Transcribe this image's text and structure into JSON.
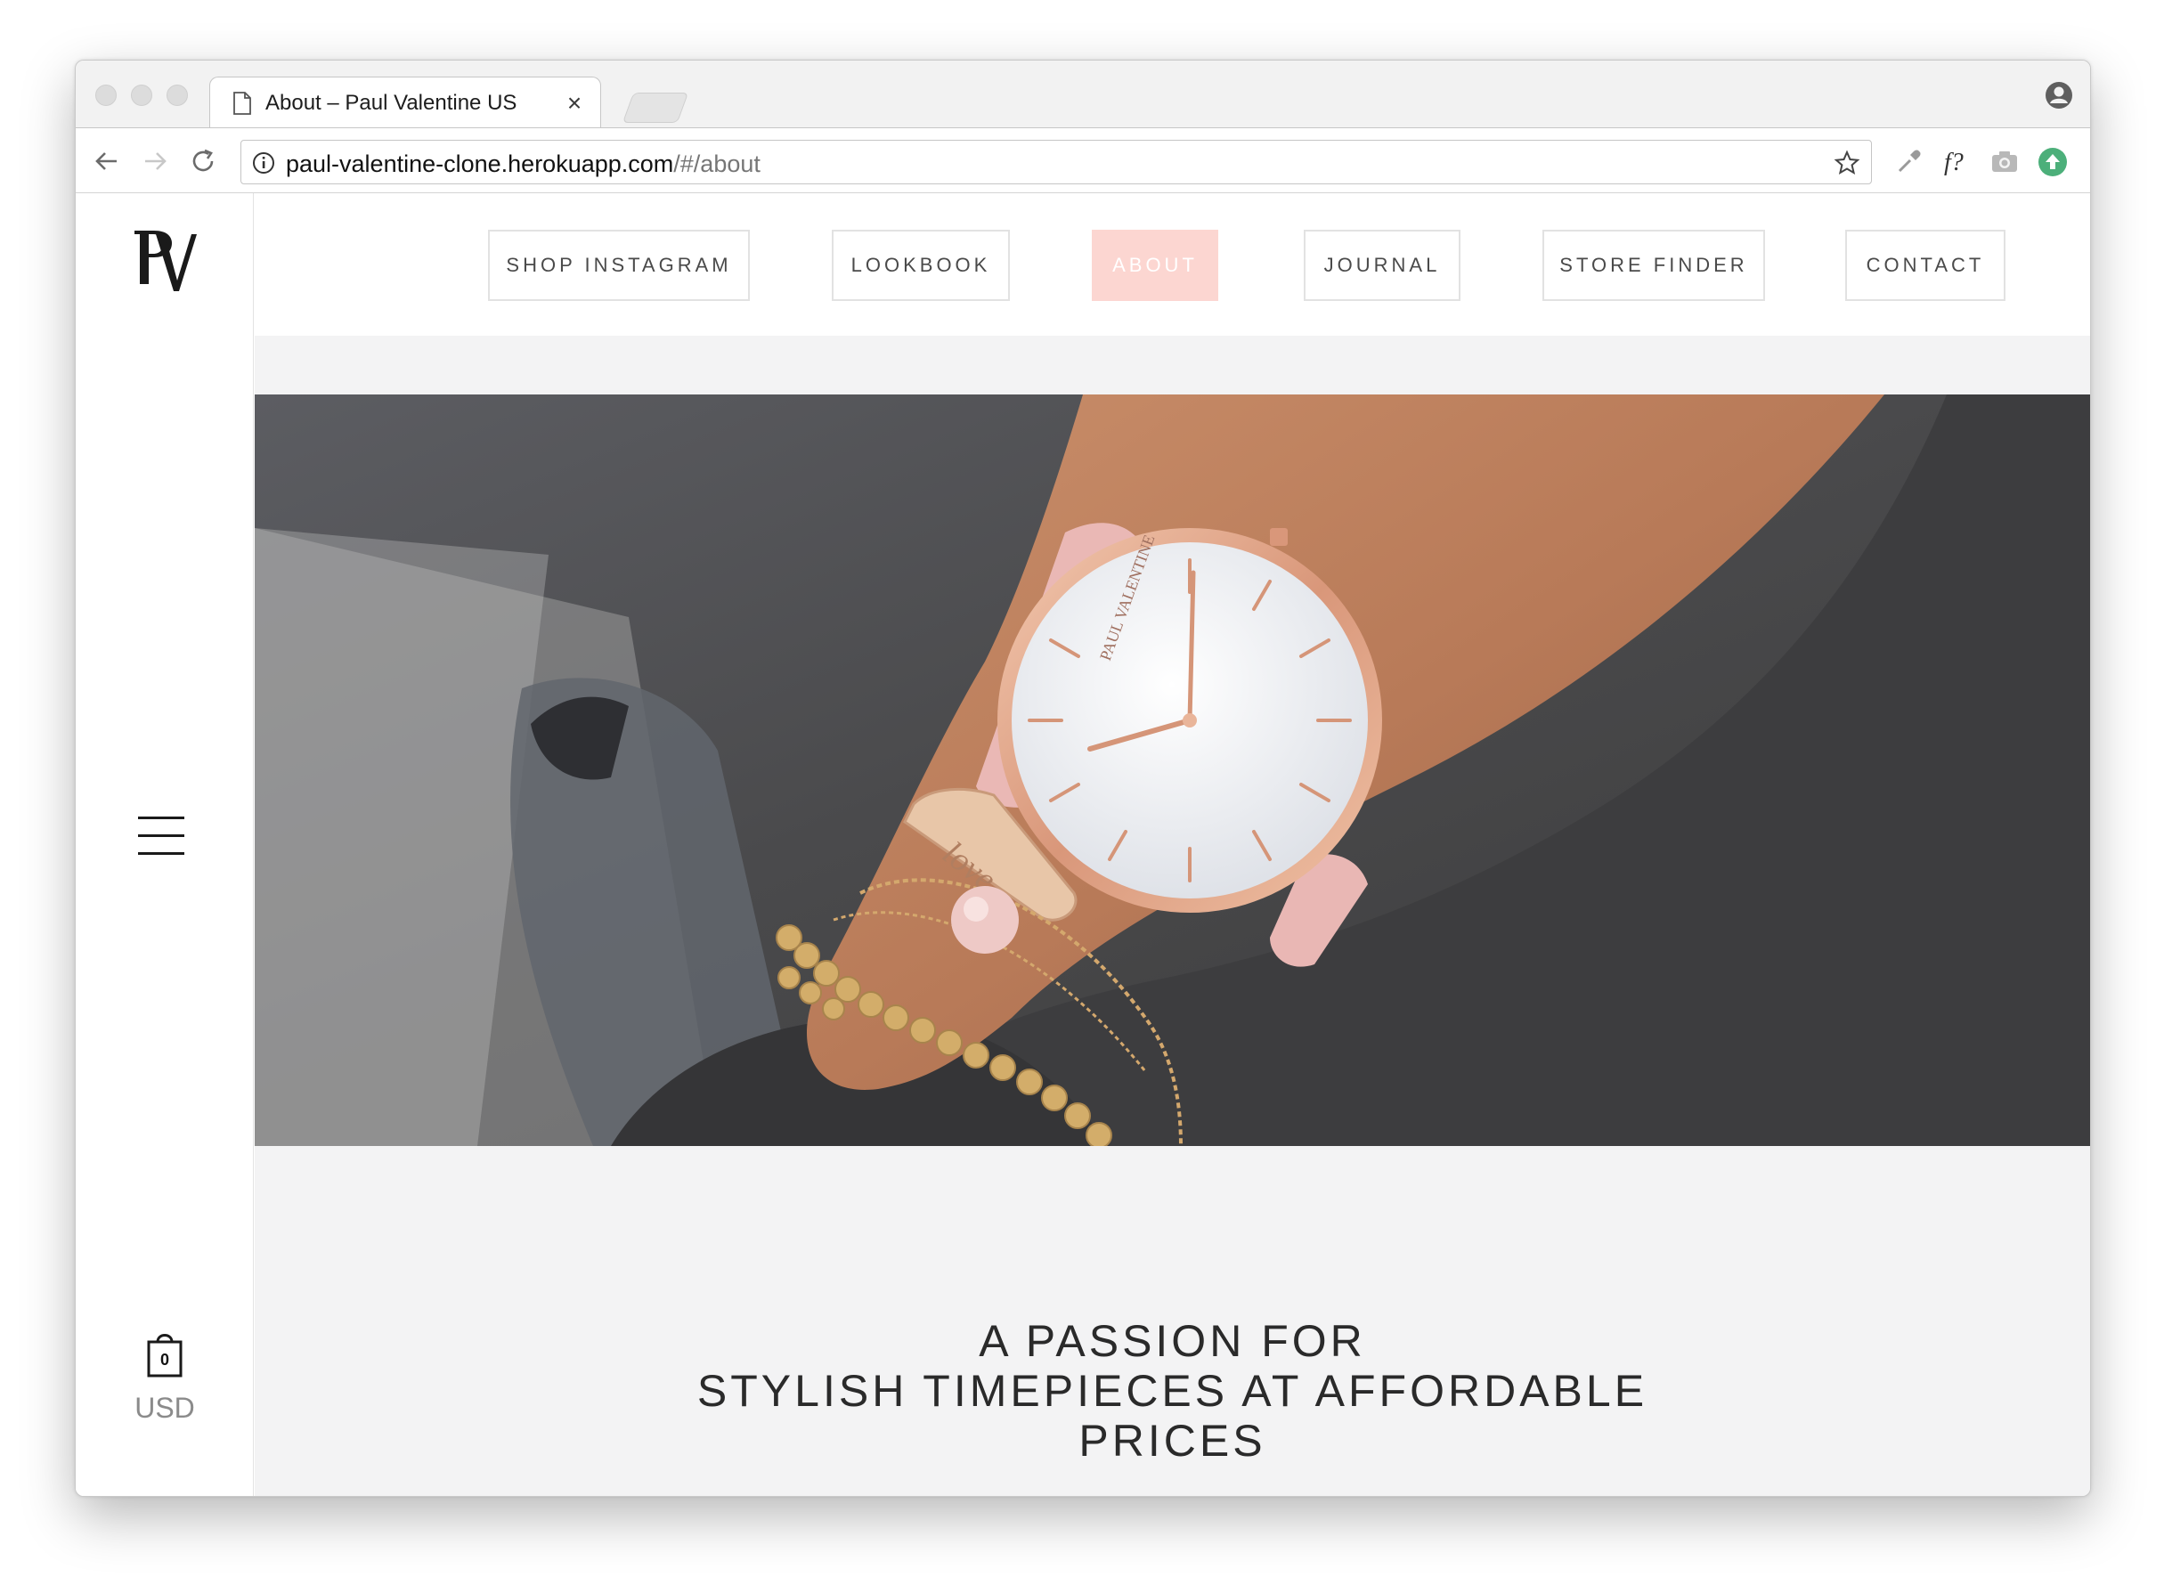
{
  "browser": {
    "tab_title": "About – Paul Valentine US",
    "tab_close": "×",
    "url_host": "paul-valentine-clone.herokuapp.com",
    "url_path": "/#/about"
  },
  "sidebar": {
    "cart_count": "0",
    "currency": "USD"
  },
  "nav": {
    "items": [
      {
        "label": "SHOP INSTAGRAM",
        "active": false
      },
      {
        "label": "LOOKBOOK",
        "active": false
      },
      {
        "label": "ABOUT",
        "active": true
      },
      {
        "label": "JOURNAL",
        "active": false
      },
      {
        "label": "STORE FINDER",
        "active": false
      },
      {
        "label": "CONTACT",
        "active": false
      }
    ]
  },
  "hero": {
    "watch_brand": "PAUL VALENTINE",
    "bracelet_text": "love"
  },
  "tagline": {
    "line1": "A PASSION FOR",
    "line2": "STYLISH TIMEPIECES AT AFFORDABLE",
    "line3": "PRICES"
  },
  "colors": {
    "accent_pink": "#fcd6d1",
    "page_bg": "#f3f3f4",
    "extension_green": "#4caf7a"
  }
}
